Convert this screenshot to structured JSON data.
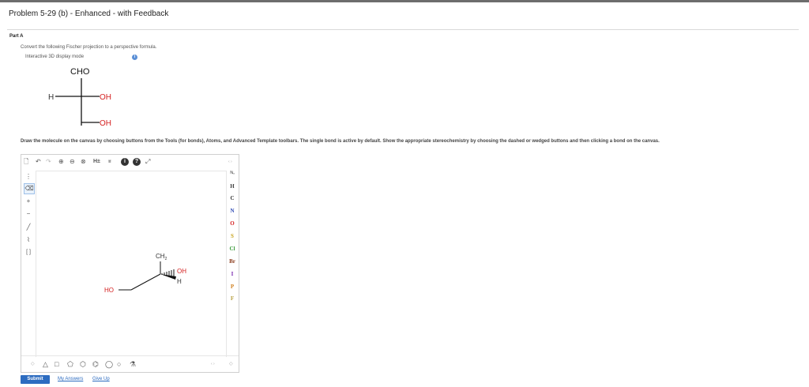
{
  "header": {
    "title": "Problem 5-29 (b) - Enhanced - with Feedback"
  },
  "part": {
    "label": "Part A"
  },
  "question": {
    "instruction": "Convert the following Fischer projection to a perspective formula.",
    "display_mode": "Interactive 3D display mode",
    "info_icon": "info-icon"
  },
  "fischer": {
    "top_group": "CHO",
    "left_group": "H",
    "right_group_1": "OH",
    "right_group_2": "OH"
  },
  "draw_instruction": "Draw the molecule on the canvas by choosing buttons from the Tools (for bonds), Atoms, and Advanced Template toolbars. The single bond is active by default. Show the appropriate stereochemistry by choosing the dashed or wedged buttons and then clicking a bond on the canvas.",
  "editor": {
    "top_toolbar": [
      {
        "name": "new-document-icon",
        "glyph": "🗋"
      },
      {
        "name": "undo-icon",
        "glyph": "↶"
      },
      {
        "name": "redo-icon",
        "glyph": "↷"
      },
      {
        "name": "zoom-in-icon",
        "glyph": "⊕"
      },
      {
        "name": "zoom-out-icon",
        "glyph": "⊖"
      },
      {
        "name": "zoom-fit-icon",
        "glyph": "⊗"
      },
      {
        "name": "hydrogens-button",
        "glyph": "H±"
      },
      {
        "name": "clean-structure-icon",
        "glyph": "⩸"
      },
      {
        "name": "info-icon",
        "glyph": "i"
      },
      {
        "name": "help-icon",
        "glyph": "?"
      },
      {
        "name": "fullscreen-icon",
        "glyph": "⤢"
      }
    ],
    "left_toolbar": [
      {
        "name": "select-tool-icon",
        "glyph": "⋮"
      },
      {
        "name": "eraser-tool-icon",
        "glyph": "⌫"
      },
      {
        "name": "plus-charge-icon",
        "glyph": "+"
      },
      {
        "name": "minus-charge-icon",
        "glyph": "−"
      },
      {
        "name": "single-bond-icon",
        "glyph": "╱"
      },
      {
        "name": "chain-tool-icon",
        "glyph": "⌇"
      },
      {
        "name": "sgroup-bracket-icon",
        "glyph": "[ ]"
      }
    ],
    "atoms": [
      {
        "symbol": "H",
        "color": "#444444"
      },
      {
        "symbol": "C",
        "color": "#333333"
      },
      {
        "symbol": "N",
        "color": "#2f4bb5"
      },
      {
        "symbol": "O",
        "color": "#d42020"
      },
      {
        "symbol": "S",
        "color": "#c7a21a"
      },
      {
        "symbol": "Cl",
        "color": "#3a9a3a"
      },
      {
        "symbol": "Br",
        "color": "#8a3a1a"
      },
      {
        "symbol": "I",
        "color": "#7a2ab0"
      },
      {
        "symbol": "P",
        "color": "#d08020"
      },
      {
        "symbol": "F",
        "color": "#b8a040"
      }
    ],
    "periodic_table_icon": "periodic-table-icon",
    "bottom_toolbar": [
      {
        "name": "triangle-template-icon",
        "glyph": "△"
      },
      {
        "name": "square-template-icon",
        "glyph": "□"
      },
      {
        "name": "pentagon-template-icon",
        "glyph": "⬠"
      },
      {
        "name": "hexagon-template-icon",
        "glyph": "⬡"
      },
      {
        "name": "benzene-template-icon",
        "glyph": "⌬"
      },
      {
        "name": "heptagon-template-icon",
        "glyph": "◯"
      },
      {
        "name": "octagon-template-icon",
        "glyph": "○"
      },
      {
        "name": "template-library-icon",
        "glyph": "⚗"
      }
    ],
    "drawn_molecule": {
      "ch2_label": "CH",
      "ch2_subscript": "2",
      "oh_label": "OH",
      "h_label": "H",
      "ho_label": "HO"
    }
  },
  "actions": {
    "submit": "Submit",
    "my_answers": "My Answers",
    "give_up": "Give Up"
  }
}
